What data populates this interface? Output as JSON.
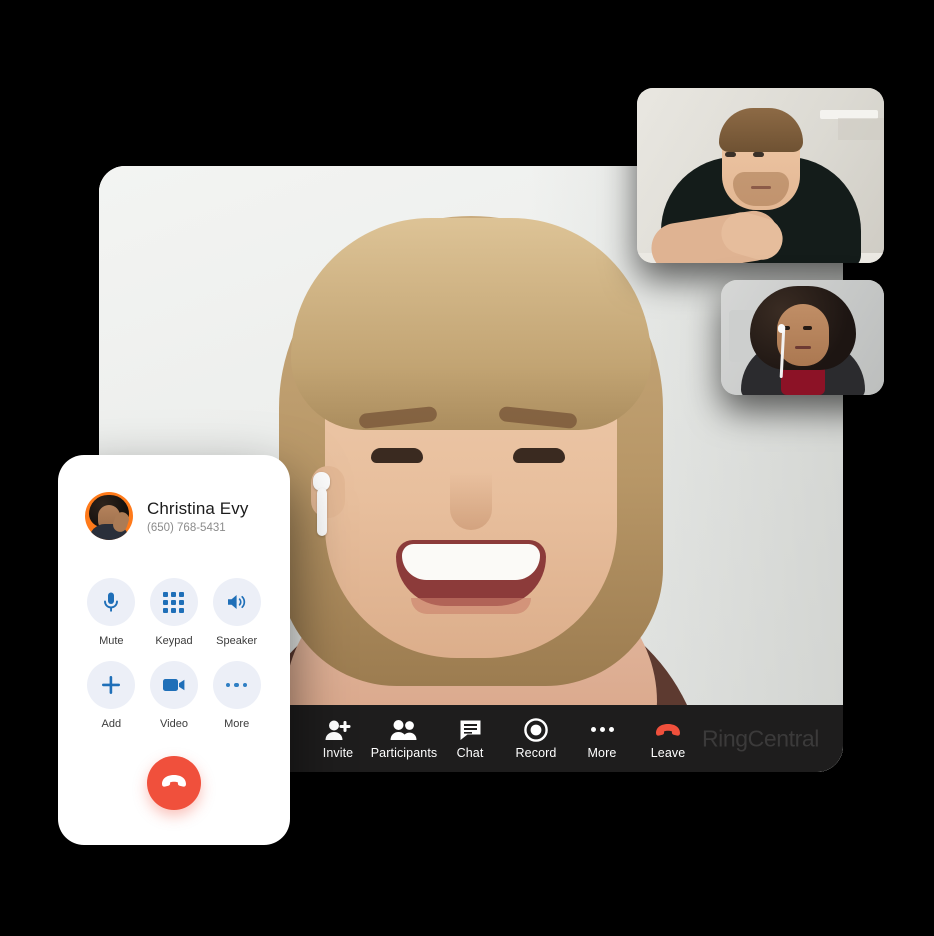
{
  "app": {
    "brand": "RingCentral",
    "brand_color": "#3b3a3a",
    "accent_blue": "#1f6fb8",
    "accent_red": "#f0503c",
    "toolbar_bg": "#1e1d1d"
  },
  "meeting": {
    "active_speaker_alt": "smiling woman with blonde hair wearing wireless earbud",
    "participants": [
      {
        "alt": "man in dark t-shirt with arms crossed",
        "position": "top-right"
      },
      {
        "alt": "woman with curly hair in red turtleneck wearing wired earphones",
        "position": "right"
      }
    ],
    "toolbar": [
      {
        "id": "invite",
        "label": "Invite",
        "icon": "person-add-icon"
      },
      {
        "id": "participants",
        "label": "Participants",
        "icon": "people-icon"
      },
      {
        "id": "chat",
        "label": "Chat",
        "icon": "chat-bubble-icon"
      },
      {
        "id": "record",
        "label": "Record",
        "icon": "record-icon"
      },
      {
        "id": "more",
        "label": "More",
        "icon": "ellipsis-icon"
      },
      {
        "id": "leave",
        "label": "Leave",
        "icon": "hangup-icon"
      }
    ]
  },
  "phone_card": {
    "caller_name": "Christina Evy",
    "caller_number": "(650) 768-5431",
    "avatar_alt": "contact photo of woman with curly hair on orange background",
    "controls": [
      {
        "id": "mute",
        "label": "Mute",
        "icon": "microphone-icon"
      },
      {
        "id": "keypad",
        "label": "Keypad",
        "icon": "keypad-icon"
      },
      {
        "id": "speaker",
        "label": "Speaker",
        "icon": "speaker-icon"
      },
      {
        "id": "add",
        "label": "Add",
        "icon": "plus-icon"
      },
      {
        "id": "video",
        "label": "Video",
        "icon": "video-camera-icon"
      },
      {
        "id": "more",
        "label": "More",
        "icon": "ellipsis-icon"
      }
    ],
    "end_call": {
      "id": "end-call",
      "label": "",
      "icon": "hangup-icon"
    }
  }
}
